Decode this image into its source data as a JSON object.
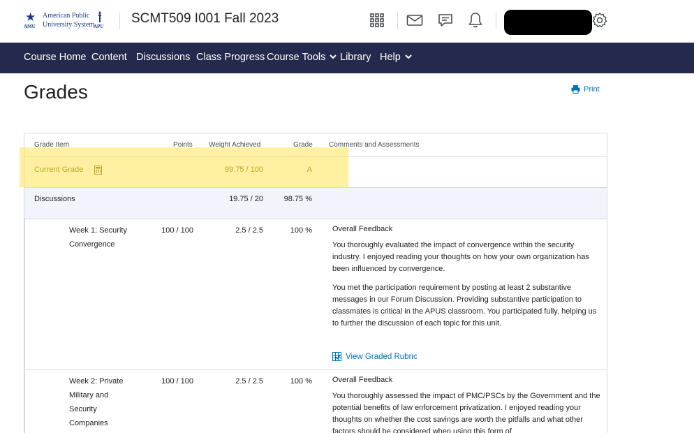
{
  "header": {
    "logo": {
      "line1": "American Public",
      "line2": "University System",
      "amu": "AMU",
      "apu": "APU"
    },
    "course_title": "SCMT509 I001 Fall 2023",
    "icons": [
      "apps-grid-icon",
      "mail-icon",
      "chat-icon",
      "bell-icon",
      "gear-icon"
    ]
  },
  "nav": {
    "items": [
      {
        "label": "Course Home"
      },
      {
        "label": "Content"
      },
      {
        "label": "Discussions"
      },
      {
        "label": "Class Progress"
      },
      {
        "label": "Course Tools",
        "dropdown": true
      },
      {
        "label": "Library"
      },
      {
        "label": "Help",
        "dropdown": true
      }
    ],
    "chevron": "⌄"
  },
  "page": {
    "title": "Grades",
    "print_label": "Print"
  },
  "table": {
    "headers": {
      "grade_item": "Grade Item",
      "points": "Points",
      "weight": "Weight Achieved",
      "grade": "Grade",
      "comments": "Comments and Assessments"
    },
    "current": {
      "label": "Current Grade",
      "weight": "99.75 / 100",
      "grade": "A"
    },
    "category": {
      "label": "Discussions",
      "weight": "19.75 / 20",
      "grade": "98.75 %"
    },
    "items": [
      {
        "name_line1": "Week 1: Security",
        "name_line2": "Convergence",
        "points": "100 / 100",
        "weight": "2.5 / 2.5",
        "grade": "100 %",
        "feedback_title": "Overall Feedback",
        "feedback_p1": "You thoroughly evaluated the impact of convergence within the security industry.  I enjoyed reading your thoughts on how your own organization has been influenced by convergence.",
        "feedback_p2": "You met the participation requirement by posting at least 2 substantive messages in our Forum Discussion.  Providing substantive participation to classmates is critical in the APUS classroom. You participated fully, helping us to further the discussion of each topic for this unit.",
        "rubric_label": "View Graded Rubric"
      },
      {
        "name_line1": "Week 2: Private",
        "name_line2": "Military and",
        "name_line3": "Security",
        "name_line4": "Companies",
        "points": "100 / 100",
        "weight": "2.5 / 2.5",
        "grade": "100 %",
        "feedback_title": "Overall Feedback",
        "feedback_p1": "You thoroughly assessed the impact of PMC/PSCs by the Government and the potential benefits of law enforcement privatization.  I enjoyed reading your thoughts on whether the cost savings are worth the pitfalls and what other factors should be considered when using this form of"
      }
    ]
  }
}
